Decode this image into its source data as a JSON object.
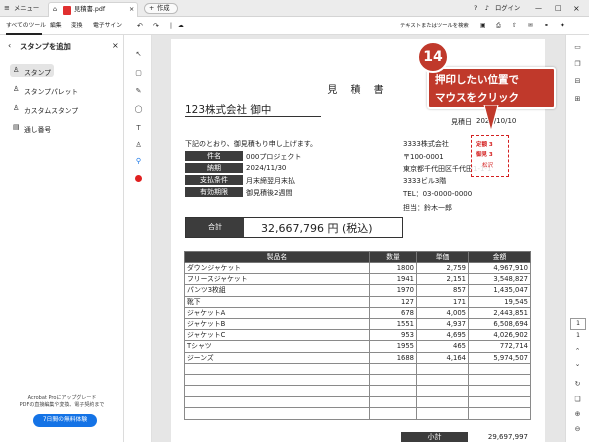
{
  "titlebar": {
    "menu_label": "メニュー",
    "tab_title": "見積書.pdf",
    "new_tab_label": "作成",
    "login_label": "ログイン"
  },
  "menubar": {
    "items": [
      "すべてのツール",
      "編集",
      "変換",
      "電子サイン"
    ],
    "search_label": "テキストまたはツールを検索"
  },
  "sidebar": {
    "title": "スタンプを追加",
    "items": [
      "スタンプ",
      "スタンプパレット",
      "カスタムスタンプ",
      "通し番号"
    ],
    "promo_line1": "Acrobat Proにアップグレード",
    "promo_line2": "PDFの直接編集や変換、電子契約まで",
    "trial_button": "7日間の無料体験"
  },
  "document": {
    "title": "見 積 書",
    "recipient": "123株式会社 御中",
    "date_label": "見積日",
    "date_value": "2024/10/10",
    "intro": "下記のとおり、御見積もり申し上げます。",
    "info": [
      {
        "label": "件名",
        "value": "000プロジェクト"
      },
      {
        "label": "納期",
        "value": "2024/11/30"
      },
      {
        "label": "支払条件",
        "value": "月末締翌月末払"
      },
      {
        "label": "有効期限",
        "value": "御見積後2週間"
      }
    ],
    "company": [
      "3333株式会社",
      "〒100-0001",
      "東京都千代田区千代田1-1-1",
      "3333ビル3階",
      "TEL：03-0000-0000",
      "担当：鈴木一郎"
    ],
    "total_label": "合計",
    "total_value": "32,667,796 円 (税込)",
    "table_headers": [
      "製品名",
      "数量",
      "単価",
      "金額"
    ],
    "rows": [
      [
        "ダウンジャケット",
        "1800",
        "2,759",
        "4,967,910"
      ],
      [
        "フリースジャケット",
        "1941",
        "2,151",
        "3,548,827"
      ],
      [
        "パンツ3枚組",
        "1970",
        "857",
        "1,435,047"
      ],
      [
        "靴下",
        "127",
        "171",
        "19,545"
      ],
      [
        "ジャケットA",
        "678",
        "4,005",
        "2,443,851"
      ],
      [
        "ジャケットB",
        "1551",
        "4,937",
        "6,508,694"
      ],
      [
        "ジャケットC",
        "953",
        "4,695",
        "4,026,902"
      ],
      [
        "Tシャツ",
        "1955",
        "465",
        "772,714"
      ],
      [
        "ジーンズ",
        "1688",
        "4,164",
        "5,974,507"
      ],
      [
        "",
        "",
        "",
        ""
      ],
      [
        "",
        "",
        "",
        ""
      ],
      [
        "",
        "",
        "",
        ""
      ],
      [
        "",
        "",
        "",
        ""
      ],
      [
        "",
        "",
        "",
        ""
      ]
    ],
    "subtotal_label": "小計",
    "subtotal_value": "29,697,997",
    "stamp_lines": [
      "定額 3",
      "御見 3",
      "松沢"
    ]
  },
  "callout": {
    "number": "14",
    "line1": "押印したい位置で",
    "line2": "マウスをクリック"
  },
  "colors": {
    "accent_red": "#c0392b",
    "header_dark": "#3c3c3c",
    "adobe_blue": "#1473e6"
  }
}
